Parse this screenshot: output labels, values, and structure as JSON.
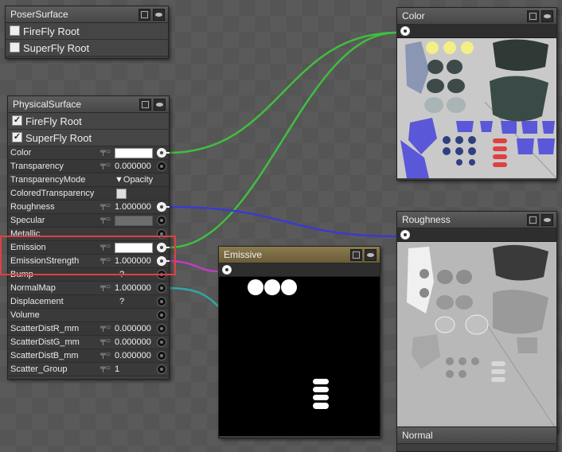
{
  "poser_surface": {
    "title": "PoserSurface",
    "rows": [
      {
        "label": "FireFly Root",
        "checked": false
      },
      {
        "label": "SuperFly Root",
        "checked": false
      }
    ]
  },
  "physical_surface": {
    "title": "PhysicalSurface",
    "checks": [
      {
        "label": "FireFly Root",
        "checked": true
      },
      {
        "label": "SuperFly Root",
        "checked": true
      }
    ],
    "params": [
      {
        "label": "Color",
        "value": ""
      },
      {
        "label": "Transparency",
        "value": "0.000000"
      },
      {
        "label": "TransparencyMode",
        "value": "▼Opacity"
      },
      {
        "label": "ColoredTransparency",
        "value": ""
      },
      {
        "label": "Roughness",
        "value": "1.000000"
      },
      {
        "label": "Specular",
        "value": ""
      },
      {
        "label": "Metallic",
        "value": ""
      },
      {
        "label": "Emission",
        "value": ""
      },
      {
        "label": "EmissionStrength",
        "value": "1.000000"
      },
      {
        "label": "Bump",
        "value": "?"
      },
      {
        "label": "NormalMap",
        "value": "1.000000"
      },
      {
        "label": "Displacement",
        "value": "?"
      },
      {
        "label": "Volume",
        "value": ""
      },
      {
        "label": "ScatterDistR_mm",
        "value": "0.000000"
      },
      {
        "label": "ScatterDistG_mm",
        "value": "0.000000"
      },
      {
        "label": "ScatterDistB_mm",
        "value": "0.000000"
      },
      {
        "label": "Scatter_Group",
        "value": "1"
      }
    ]
  },
  "color_node": {
    "title": "Color"
  },
  "roughness_node": {
    "title": "Roughness"
  },
  "emissive_node": {
    "title": "Emissive"
  },
  "normal_node": {
    "title": "Normal"
  },
  "colors": {
    "wire_green": "#3fbf3f",
    "wire_blue": "#3a3acf",
    "wire_magenta": "#c03cc0",
    "wire_teal": "#2fa8a8",
    "highlight": "#e04040"
  }
}
